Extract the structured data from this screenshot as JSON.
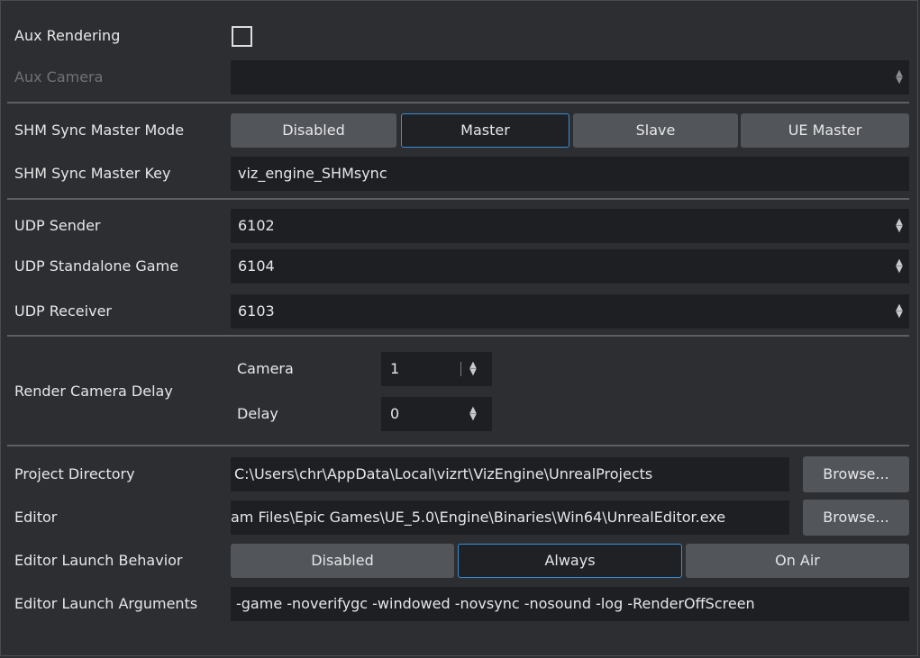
{
  "aux": {
    "rendering_label": "Aux Rendering",
    "camera_label": "Aux Camera",
    "camera_value": ""
  },
  "shm": {
    "mode_label": "SHM Sync Master Mode",
    "mode_options": [
      "Disabled",
      "Master",
      "Slave",
      "UE Master"
    ],
    "mode_selected": "Master",
    "key_label": "SHM Sync Master Key",
    "key_value": "viz_engine_SHMsync"
  },
  "udp": {
    "sender_label": "UDP Sender",
    "sender_value": "6102",
    "standalone_label": "UDP Standalone Game",
    "standalone_value": "6104",
    "receiver_label": "UDP Receiver",
    "receiver_value": "6103"
  },
  "render_delay": {
    "label": "Render Camera Delay",
    "camera_label": "Camera",
    "camera_value": "1",
    "delay_label": "Delay",
    "delay_value": "0"
  },
  "project": {
    "directory_label": "Project Directory",
    "directory_value": "C:\\Users\\chr\\AppData\\Local\\vizrt\\VizEngine\\UnrealProjects",
    "directory_browse": "Browse...",
    "editor_label": "Editor",
    "editor_value": "am Files\\Epic Games\\UE_5.0\\Engine\\Binaries\\Win64\\UnrealEditor.exe",
    "editor_browse": "Browse...",
    "launch_behavior_label": "Editor Launch Behavior",
    "launch_behavior_options": [
      "Disabled",
      "Always",
      "On Air"
    ],
    "launch_behavior_selected": "Always",
    "launch_args_label": "Editor Launch Arguments",
    "launch_args_value": "-game -noverifygc -windowed -novsync -nosound -log -RenderOffScreen"
  },
  "icons": {
    "spinner": "up-down-arrows-icon"
  },
  "colors": {
    "background": "#2d2e31",
    "field": "#1d1f22",
    "button": "#52555a",
    "accent": "#3a8fd6",
    "disabled_text": "#6f7276"
  }
}
